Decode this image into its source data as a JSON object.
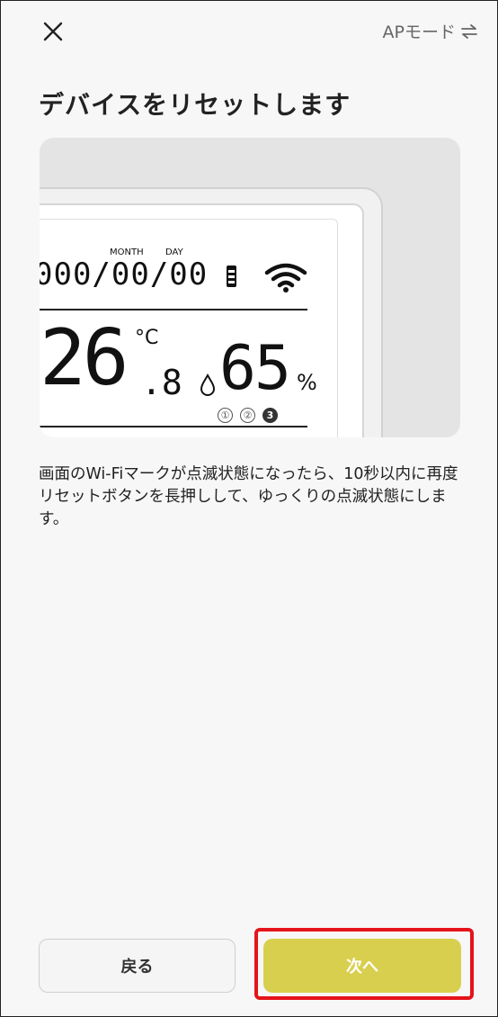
{
  "header": {
    "close_icon": "close-icon",
    "ap_mode_label": "APモード",
    "swap_icon": "swap-arrows-icon"
  },
  "page": {
    "title": "デバイスをリセットします",
    "description": "画面のWi-Fiマークが点滅状態になったら、10秒以内に再度リセットボタンを長押しして、ゆっくりの点滅状態にします。"
  },
  "illustration": {
    "month_label": "MONTH",
    "day_label": "DAY",
    "date_display": "000/00/00",
    "temperature_value": "26",
    "temperature_decimal": ".8",
    "temperature_unit": "°C",
    "humidity_value": "65",
    "humidity_unit": "%",
    "indicators": [
      "①",
      "②",
      "3"
    ],
    "active_indicator": 3
  },
  "footer": {
    "back_label": "戻る",
    "next_label": "次へ"
  },
  "colors": {
    "accent": "#d9cf4e",
    "highlight": "#e5141b",
    "background": "#f7f7f7"
  }
}
